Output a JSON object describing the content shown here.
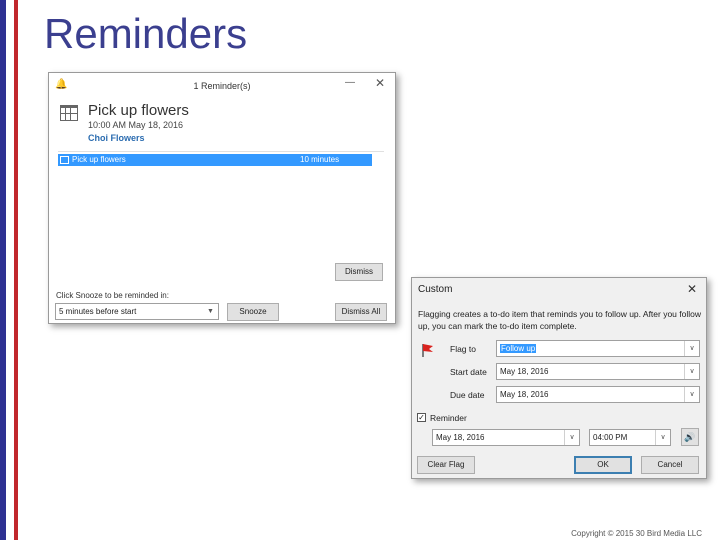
{
  "slide": {
    "title": "Reminders",
    "copyright": "Copyright © 2015 30 Bird Media LLC"
  },
  "reminder_window": {
    "title": "1 Reminder(s)",
    "subject": "Pick up flowers",
    "when": "10:00 AM May 18, 2016",
    "location": "Choi Flowers",
    "rows": [
      {
        "subject": "Pick up flowers",
        "due_in": "10 minutes"
      }
    ],
    "dismiss_label": "Dismiss",
    "snooze_prompt": "Click Snooze to be reminded in:",
    "snooze_value": "5 minutes before start",
    "snooze_label": "Snooze",
    "dismiss_all_label": "Dismiss All",
    "icons": {
      "app": "bell-icon",
      "minimize": "minimize-icon",
      "close": "close-icon",
      "item": "calendar-icon"
    }
  },
  "custom_dialog": {
    "title": "Custom",
    "description": "Flagging creates a to-do item that reminds you to follow up. After you follow up, you can mark the to-do item complete.",
    "flag_to_label": "Flag to",
    "flag_to_value": "Follow up",
    "start_date_label": "Start date",
    "start_date_value": "May 18, 2016",
    "due_date_label": "Due date",
    "due_date_value": "May 18, 2016",
    "reminder_label": "Reminder",
    "reminder_checked": true,
    "reminder_date": "May 18, 2016",
    "reminder_time": "04:00 PM",
    "clear_flag_label": "Clear Flag",
    "ok_label": "OK",
    "cancel_label": "Cancel",
    "icons": {
      "flag": "red-flag-icon",
      "sound": "sound-icon",
      "close": "close-icon"
    }
  },
  "colors": {
    "accent_blue": "#3399ff",
    "title_blue": "#3b3f8f",
    "slide_bar_blue": "#2e3192",
    "slide_bar_red": "#c1272d"
  }
}
